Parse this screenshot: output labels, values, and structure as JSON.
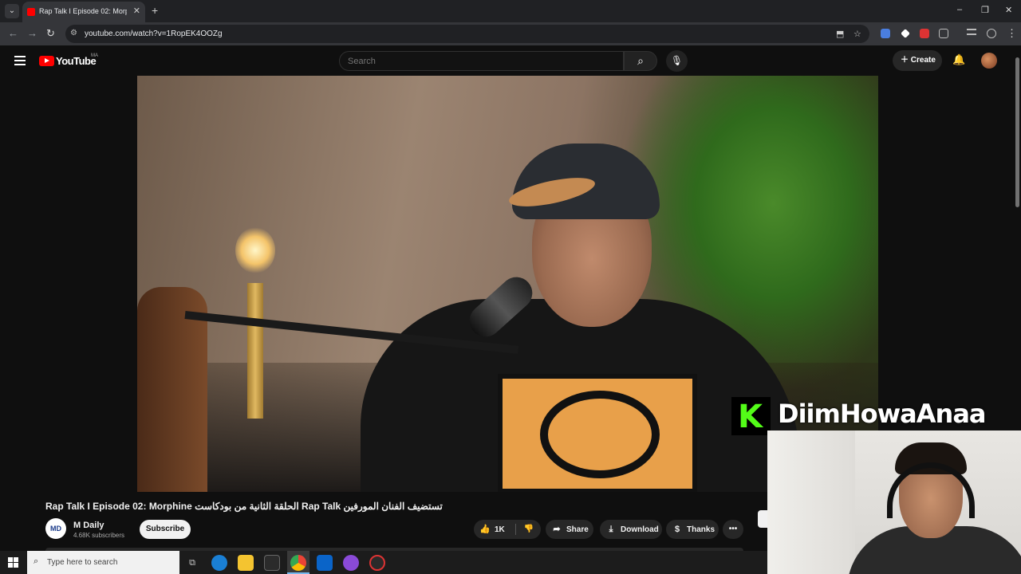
{
  "browser": {
    "tab_title": "Rap Talk I Episode 02: Morp",
    "tab_close": "✕",
    "new_tab": "+",
    "url": "youtube.com/watch?v=1RopEK4OOZg",
    "window_controls": {
      "minimize": "–",
      "maximize": "❐",
      "close": "✕"
    }
  },
  "youtube": {
    "logo_text": "YouTube",
    "region": "MA",
    "search_placeholder": "Search",
    "create_label": "Create"
  },
  "video": {
    "title": "Rap Talk I Episode 02: Morphine الحلقة الثانية من بودكاست Rap Talk تستضيف الفنان المورفين",
    "channel_avatar_text": "MD",
    "channel_name": "M Daily",
    "subscribers": "4.68K subscribers",
    "subscribe_label": "Subscribe",
    "like_count": "1K",
    "share_label": "Share",
    "download_label": "Download",
    "thanks_label": "Thanks",
    "more_label": "•••"
  },
  "overlay": {
    "channel_letter": "K",
    "streamer_name": "DiimHowaAnaa"
  },
  "taskbar": {
    "search_placeholder": "Type here to search"
  },
  "colors": {
    "youtube_red": "#ff0000",
    "kick_green": "#53fc18",
    "background": "#0f0f0f"
  }
}
